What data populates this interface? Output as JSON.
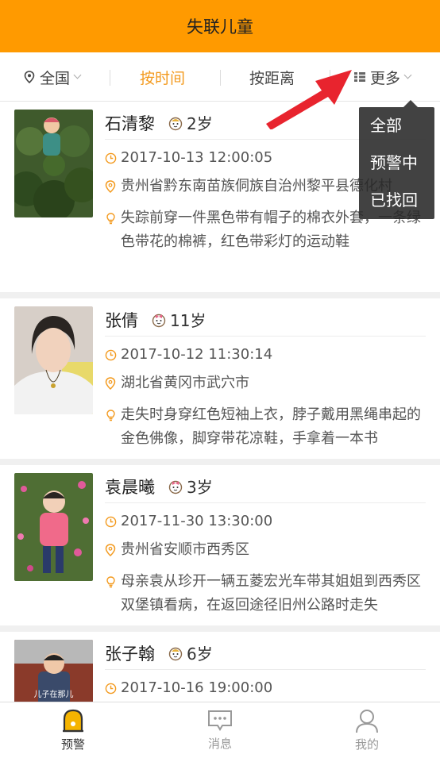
{
  "header": {
    "title": "失联儿童"
  },
  "filters": {
    "region": "全国",
    "by_time": "按时间",
    "by_distance": "按距离",
    "more": "更多"
  },
  "dropdown": {
    "items": [
      "全部",
      "预警中",
      "已找回"
    ]
  },
  "children": [
    {
      "name": "石清黎",
      "gender": "boy",
      "age": "2岁",
      "time": "2017-10-13 12:00:05",
      "location": "贵州省黔东南苗族侗族自治州黎平县德化村",
      "description": "失踪前穿一件黑色带有帽子的棉衣外套，一条绿色带花的棉裤，红色带彩灯的运动鞋"
    },
    {
      "name": "张倩",
      "gender": "girl",
      "age": "11岁",
      "time": "2017-10-12 11:30:14",
      "location": "湖北省黄冈市武穴市",
      "description": "走失时身穿红色短袖上衣，脖子戴用黑绳串起的金色佛像，脚穿带花凉鞋，手拿着一本书"
    },
    {
      "name": "袁晨曦",
      "gender": "girl",
      "age": "3岁",
      "time": "2017-11-30 13:30:00",
      "location": "贵州省安顺市西秀区",
      "description": "母亲袁从珍开一辆五菱宏光车带其姐姐到西秀区双堡镇看病，在返回途径旧州公路时走失"
    },
    {
      "name": "张子翰",
      "gender": "boy",
      "age": "6岁",
      "time": "2017-10-16 19:00:00",
      "photo_caption": "儿子在那儿",
      "location": "",
      "description": ""
    }
  ],
  "tabs": [
    {
      "label": "预警",
      "icon": "alert-bell-icon",
      "active": true
    },
    {
      "label": "消息",
      "icon": "message-icon",
      "active": false
    },
    {
      "label": "我的",
      "icon": "user-icon",
      "active": false
    }
  ],
  "colors": {
    "brand": "#ff9a00",
    "accent": "#f39a1e",
    "active_icon": "#f5b400"
  }
}
